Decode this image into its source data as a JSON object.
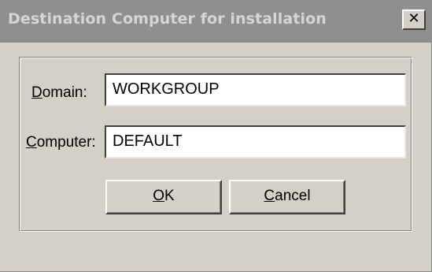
{
  "window": {
    "title": "Destination Computer for installation",
    "close_glyph": "✕",
    "close_icon": "close-icon"
  },
  "form": {
    "domain": {
      "label_mnemonic": "D",
      "label_rest": "omain:",
      "value": "WORKGROUP"
    },
    "computer": {
      "label_mnemonic": "C",
      "label_rest": "omputer:",
      "value": "DEFAULT"
    }
  },
  "buttons": {
    "ok": {
      "mnemonic": "O",
      "rest": "K"
    },
    "cancel": {
      "mnemonic": "C",
      "rest": "ancel"
    }
  },
  "colors": {
    "titlebar_inactive": "#8f8f8f",
    "title_text": "#d6d6d6",
    "face": "#d4d0c8"
  }
}
